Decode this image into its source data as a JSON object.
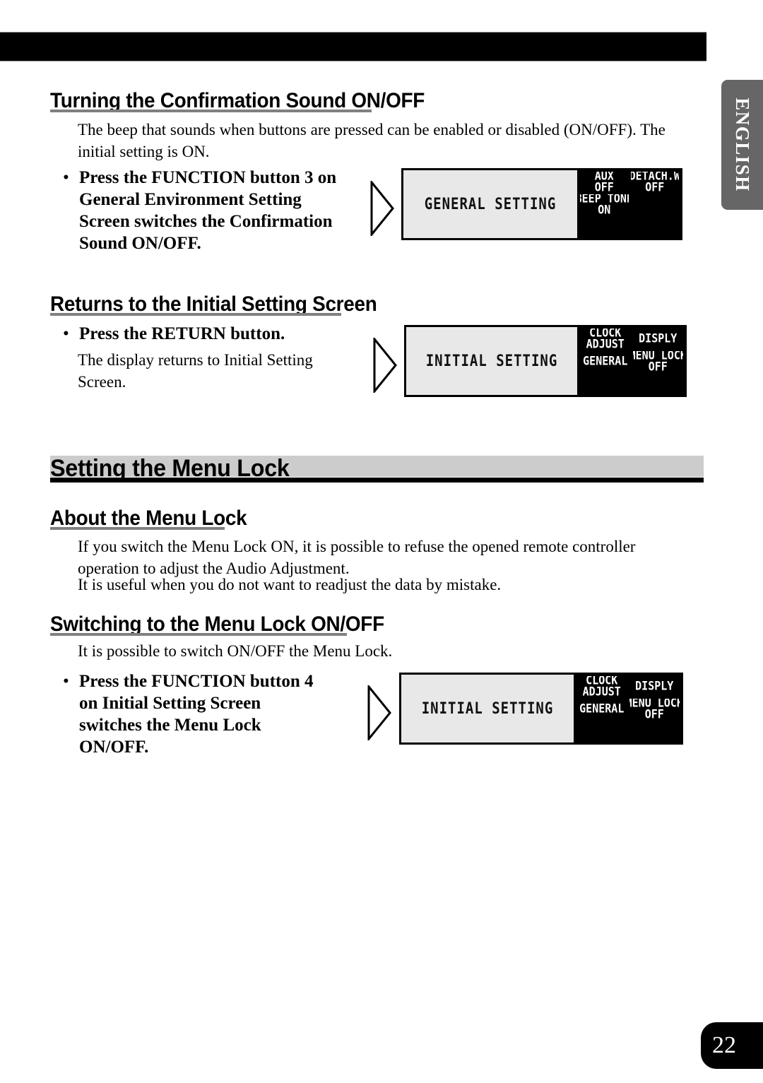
{
  "document": {
    "language_tab": "ENGLISH",
    "page_number": "22"
  },
  "sections": [
    {
      "heading": "Turning the Confirmation Sound ON/OFF",
      "body": "The beep that sounds when buttons are pressed can be enabled or disabled (ON/OFF). The initial setting is ON.",
      "instruction": "Press the FUNCTION button 3 on General Environment Setting Screen switches the Confirmation Sound ON/OFF."
    },
    {
      "heading": "Returns to the Initial Setting Screen",
      "instruction": "Press the RETURN button.",
      "body": "The display returns to Initial Setting Screen."
    },
    {
      "heading": "Setting the Menu Lock"
    },
    {
      "heading": "About the Menu Lock",
      "body_line1": "If you switch the Menu Lock ON, it is possible to refuse the opened remote controller operation to adjust the Audio Adjustment.",
      "body_line2": "It is useful when you do not want to readjust the data by mistake."
    },
    {
      "heading": "Switching to the Menu Lock ON/OFF",
      "body": "It is possible to switch ON/OFF the Menu Lock.",
      "instruction": "Press the FUNCTION button 4 on Initial Setting Screen switches the Menu Lock ON/OFF."
    }
  ],
  "displays": [
    {
      "title": "GENERAL SETTING",
      "cells": [
        {
          "line1": "AUX",
          "line2": "OFF"
        },
        {
          "line1": "DETACH.W",
          "line2": "OFF"
        },
        {
          "line1": "BEEP TONE",
          "line2": "ON"
        },
        {
          "line1": "",
          "line2": ""
        },
        {
          "line1": "",
          "line2": ""
        },
        {
          "line1": "",
          "line2": ""
        }
      ]
    },
    {
      "title": "INITIAL SETTING",
      "cells": [
        {
          "line1": "CLOCK",
          "line2": "ADJUST"
        },
        {
          "line1": "DISPLY",
          "line2": ""
        },
        {
          "line1": "GENERAL",
          "line2": ""
        },
        {
          "line1": "MENU LOCK",
          "line2": "OFF"
        },
        {
          "line1": "",
          "line2": ""
        },
        {
          "line1": "",
          "line2": ""
        }
      ]
    },
    {
      "title": "INITIAL SETTING",
      "cells": [
        {
          "line1": "CLOCK",
          "line2": "ADJUST"
        },
        {
          "line1": "DISPLY",
          "line2": ""
        },
        {
          "line1": "GENERAL",
          "line2": ""
        },
        {
          "line1": "MENU LOCK",
          "line2": "OFF"
        },
        {
          "line1": "",
          "line2": ""
        },
        {
          "line1": "",
          "line2": ""
        }
      ]
    }
  ],
  "colors": {
    "heading_rule": "#808080",
    "banner_band": "#cccccc",
    "lcd_background": "#e8e8e8",
    "lcd_grid": "#000000",
    "side_tab": "#666666"
  }
}
